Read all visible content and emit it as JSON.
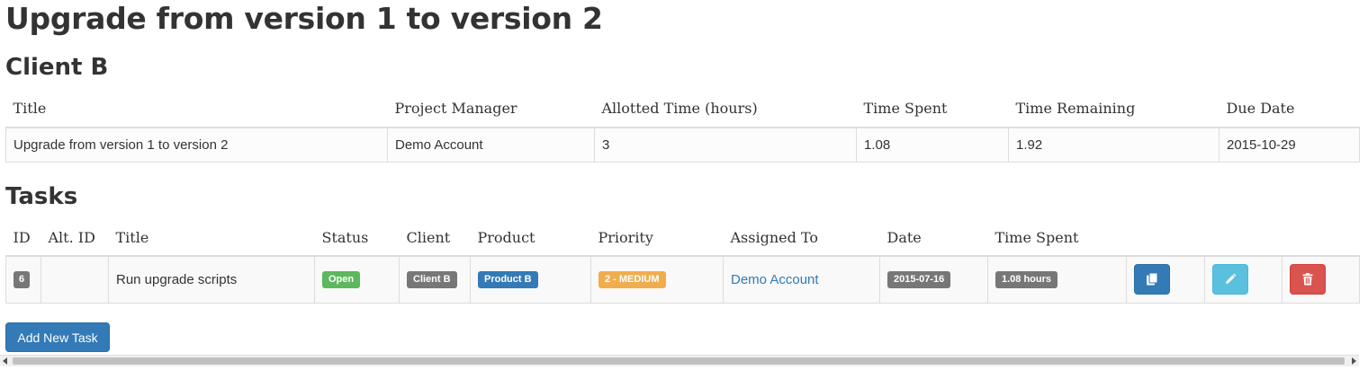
{
  "page": {
    "title": "Upgrade from version 1 to version 2"
  },
  "client": {
    "heading": "Client B",
    "columns": [
      "Title",
      "Project Manager",
      "Allotted Time (hours)",
      "Time Spent",
      "Time Remaining",
      "Due Date"
    ],
    "row": [
      "Upgrade from version 1 to version 2",
      "Demo Account",
      "3",
      "1.08",
      "1.92",
      "2015-10-29"
    ]
  },
  "tasks": {
    "heading": "Tasks",
    "columns": [
      "ID",
      "Alt. ID",
      "Title",
      "Status",
      "Client",
      "Product",
      "Priority",
      "Assigned To",
      "Date",
      "Time Spent"
    ],
    "rows": [
      {
        "id": "6",
        "alt_id": "",
        "title": "Run upgrade scripts",
        "status": "Open",
        "client": "Client B",
        "product": "Product B",
        "priority": "2 - MEDIUM",
        "assigned_to": "Demo Account",
        "date": "2015-07-16",
        "time_spent": "1.08 hours",
        "actions": [
          "copy-icon",
          "pencil-icon",
          "trash-icon"
        ]
      }
    ],
    "add_button_label": "Add New Task"
  },
  "colors": {
    "primary": "#337ab7",
    "success": "#5cb85c",
    "warning": "#f0ad4e",
    "info": "#5bc0de",
    "danger": "#d9534f",
    "default": "#777777"
  }
}
